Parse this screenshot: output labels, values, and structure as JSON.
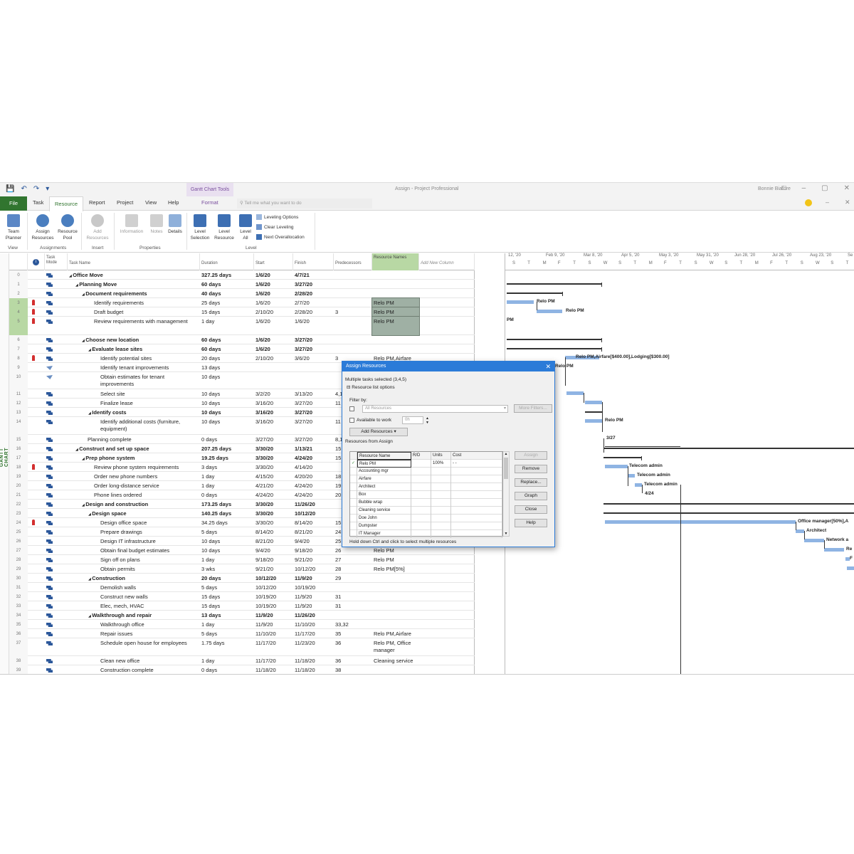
{
  "title_bar": {
    "context_tab": "Gantt Chart Tools",
    "window_title": "Assign  -  Project Professional",
    "user": "Bonnie Biafore"
  },
  "tabs": {
    "file": "File",
    "task": "Task",
    "resource": "Resource",
    "report": "Report",
    "project": "Project",
    "view": "View",
    "help": "Help",
    "format": "Format",
    "tell_me": "Tell me what you want to do"
  },
  "ribbon": {
    "team_planner": "Team Planner",
    "assign_resources": "Assign Resources",
    "resource_pool": "Resource Pool",
    "add_resources": "Add Resources",
    "information": "Information",
    "notes": "Notes",
    "details": "Details",
    "level_selection": "Level Selection",
    "level_resource": "Level Resource",
    "level_all": "Level All",
    "leveling_options": "Leveling Options",
    "clear_leveling": "Clear Leveling",
    "next_overallocation": "Next Overallocation",
    "groups": {
      "view": "View",
      "assignments": "Assignments",
      "insert": "Insert",
      "properties": "Properties",
      "level": "Level"
    }
  },
  "sheet": {
    "side_label": "GANTT CHART",
    "headers": {
      "task_mode": "Task Mode",
      "task_name": "Task Name",
      "duration": "Duration",
      "start": "Start",
      "finish": "Finish",
      "predecessors": "Predecessors",
      "resource_names": "Resource Names",
      "add_column": "Add New Column"
    },
    "rows": [
      {
        "id": "0",
        "name": "Office Move",
        "dur": "327.25 days",
        "start": "1/6/20",
        "fin": "4/7/21",
        "pred": "",
        "res": "",
        "lvl": 0,
        "bold": true,
        "h": 13
      },
      {
        "id": "1",
        "name": "Planning Move",
        "dur": "60 days",
        "start": "1/6/20",
        "fin": "3/27/20",
        "pred": "",
        "res": "",
        "lvl": 1,
        "bold": true,
        "h": 13
      },
      {
        "id": "2",
        "name": "Document requirements",
        "dur": "40 days",
        "start": "1/6/20",
        "fin": "2/28/20",
        "pred": "",
        "res": "",
        "lvl": 2,
        "bold": true,
        "h": 13
      },
      {
        "id": "3",
        "name": "Identify requirements",
        "dur": "25 days",
        "start": "1/6/20",
        "fin": "2/7/20",
        "pred": "",
        "res": "Relo PM",
        "lvl": 3,
        "bold": false,
        "h": 13,
        "pin": true,
        "hl": true
      },
      {
        "id": "4",
        "name": "Draft budget",
        "dur": "15 days",
        "start": "2/10/20",
        "fin": "2/28/20",
        "pred": "3",
        "res": "Relo PM",
        "lvl": 3,
        "bold": false,
        "h": 13,
        "pin": true,
        "hl": true
      },
      {
        "id": "5",
        "name": "Review requirements with management",
        "dur": "1 day",
        "start": "1/6/20",
        "fin": "1/6/20",
        "pred": "",
        "res": "Relo PM",
        "lvl": 3,
        "bold": false,
        "h": 26,
        "pin": true,
        "hl": true
      },
      {
        "id": "6",
        "name": "Choose new location",
        "dur": "60 days",
        "start": "1/6/20",
        "fin": "3/27/20",
        "pred": "",
        "res": "",
        "lvl": 2,
        "bold": true,
        "h": 13
      },
      {
        "id": "7",
        "name": "Evaluate lease sites",
        "dur": "60 days",
        "start": "1/6/20",
        "fin": "3/27/20",
        "pred": "",
        "res": "",
        "lvl": 3,
        "bold": true,
        "h": 13
      },
      {
        "id": "8",
        "name": "Identify potential sites",
        "dur": "20 days",
        "start": "2/10/20",
        "fin": "3/6/20",
        "pred": "3",
        "res": "Relo PM,Airfare",
        "lvl": 4,
        "bold": false,
        "h": 13,
        "pin": true
      },
      {
        "id": "9",
        "name": "Identify tenant improvements",
        "dur": "13 days",
        "start": "",
        "fin": "",
        "pred": "",
        "res": "",
        "lvl": 4,
        "bold": false,
        "h": 13,
        "manual": true
      },
      {
        "id": "10",
        "name": "Obtain estimates for tenant improvements",
        "dur": "10 days",
        "start": "",
        "fin": "",
        "pred": "",
        "res": "",
        "lvl": 4,
        "bold": false,
        "h": 24,
        "manual": true
      },
      {
        "id": "11",
        "name": "Select site",
        "dur": "10 days",
        "start": "3/2/20",
        "fin": "3/13/20",
        "pred": "4,1",
        "res": "",
        "lvl": 4,
        "bold": false,
        "h": 13
      },
      {
        "id": "12",
        "name": "Finalize lease",
        "dur": "10 days",
        "start": "3/16/20",
        "fin": "3/27/20",
        "pred": "11",
        "res": "",
        "lvl": 4,
        "bold": false,
        "h": 13
      },
      {
        "id": "13",
        "name": "Identify costs",
        "dur": "10 days",
        "start": "3/16/20",
        "fin": "3/27/20",
        "pred": "",
        "res": "",
        "lvl": 3,
        "bold": true,
        "h": 13
      },
      {
        "id": "14",
        "name": "Identify additional costs (furniture, equipment)",
        "dur": "10 days",
        "start": "3/16/20",
        "fin": "3/27/20",
        "pred": "11",
        "res": "",
        "lvl": 4,
        "bold": false,
        "h": 25
      },
      {
        "id": "15",
        "name": "Planning complete",
        "dur": "0 days",
        "start": "3/27/20",
        "fin": "3/27/20",
        "pred": "8,1",
        "res": "",
        "lvl": 2,
        "bold": false,
        "h": 13
      },
      {
        "id": "16",
        "name": "Construct and set up space",
        "dur": "207.25 days",
        "start": "3/30/20",
        "fin": "1/13/21",
        "pred": "15",
        "res": "",
        "lvl": 1,
        "bold": true,
        "h": 13
      },
      {
        "id": "17",
        "name": "Prep phone system",
        "dur": "19.25 days",
        "start": "3/30/20",
        "fin": "4/24/20",
        "pred": "15",
        "res": "",
        "lvl": 2,
        "bold": true,
        "h": 13
      },
      {
        "id": "18",
        "name": "Review phone system requirements",
        "dur": "3 days",
        "start": "3/30/20",
        "fin": "4/14/20",
        "pred": "",
        "res": "",
        "lvl": 3,
        "bold": false,
        "h": 13,
        "pin": true
      },
      {
        "id": "19",
        "name": "Order new phone numbers",
        "dur": "1 day",
        "start": "4/15/20",
        "fin": "4/20/20",
        "pred": "18",
        "res": "",
        "lvl": 3,
        "bold": false,
        "h": 13
      },
      {
        "id": "20",
        "name": "Order long-distance service",
        "dur": "1 day",
        "start": "4/21/20",
        "fin": "4/24/20",
        "pred": "19",
        "res": "",
        "lvl": 3,
        "bold": false,
        "h": 13
      },
      {
        "id": "21",
        "name": "Phone lines ordered",
        "dur": "0 days",
        "start": "4/24/20",
        "fin": "4/24/20",
        "pred": "20",
        "res": "",
        "lvl": 3,
        "bold": false,
        "h": 13
      },
      {
        "id": "22",
        "name": "Design and construction",
        "dur": "173.25 days",
        "start": "3/30/20",
        "fin": "11/26/20",
        "pred": "",
        "res": "",
        "lvl": 2,
        "bold": true,
        "h": 13
      },
      {
        "id": "23",
        "name": "Design space",
        "dur": "140.25 days",
        "start": "3/30/20",
        "fin": "10/12/20",
        "pred": "",
        "res": "",
        "lvl": 3,
        "bold": true,
        "h": 13
      },
      {
        "id": "24",
        "name": "Design office space",
        "dur": "34.25 days",
        "start": "3/30/20",
        "fin": "8/14/20",
        "pred": "15",
        "res": "",
        "lvl": 4,
        "bold": false,
        "h": 13,
        "pin": true
      },
      {
        "id": "25",
        "name": "Prepare drawings",
        "dur": "5 days",
        "start": "8/14/20",
        "fin": "8/21/20",
        "pred": "24",
        "res": "",
        "lvl": 4,
        "bold": false,
        "h": 13
      },
      {
        "id": "26",
        "name": "Design IT infrastructure",
        "dur": "10 days",
        "start": "8/21/20",
        "fin": "9/4/20",
        "pred": "25",
        "res": "",
        "lvl": 4,
        "bold": false,
        "h": 13
      },
      {
        "id": "27",
        "name": "Obtain final budget estimates",
        "dur": "10 days",
        "start": "9/4/20",
        "fin": "9/18/20",
        "pred": "26",
        "res": "Relo PM",
        "lvl": 4,
        "bold": false,
        "h": 13
      },
      {
        "id": "28",
        "name": "Sign off on plans",
        "dur": "1 day",
        "start": "9/18/20",
        "fin": "9/21/20",
        "pred": "27",
        "res": "Relo PM",
        "lvl": 4,
        "bold": false,
        "h": 13
      },
      {
        "id": "29",
        "name": "Obtain permits",
        "dur": "3 wks",
        "start": "9/21/20",
        "fin": "10/12/20",
        "pred": "28",
        "res": "Relo PM[5%]",
        "lvl": 4,
        "bold": false,
        "h": 13
      },
      {
        "id": "30",
        "name": "Construction",
        "dur": "20 days",
        "start": "10/12/20",
        "fin": "11/9/20",
        "pred": "29",
        "res": "",
        "lvl": 3,
        "bold": true,
        "h": 13
      },
      {
        "id": "31",
        "name": "Demolish walls",
        "dur": "5 days",
        "start": "10/12/20",
        "fin": "10/19/20",
        "pred": "",
        "res": "",
        "lvl": 4,
        "bold": false,
        "h": 13
      },
      {
        "id": "32",
        "name": "Construct new walls",
        "dur": "15 days",
        "start": "10/19/20",
        "fin": "11/9/20",
        "pred": "31",
        "res": "",
        "lvl": 4,
        "bold": false,
        "h": 13
      },
      {
        "id": "33",
        "name": "Elec, mech, HVAC",
        "dur": "15 days",
        "start": "10/19/20",
        "fin": "11/9/20",
        "pred": "31",
        "res": "",
        "lvl": 4,
        "bold": false,
        "h": 13
      },
      {
        "id": "34",
        "name": "Walkthrough and repair",
        "dur": "13 days",
        "start": "11/9/20",
        "fin": "11/26/20",
        "pred": "",
        "res": "",
        "lvl": 3,
        "bold": true,
        "h": 13
      },
      {
        "id": "35",
        "name": "Walkthrough office",
        "dur": "1 day",
        "start": "11/9/20",
        "fin": "11/10/20",
        "pred": "33,32",
        "res": "",
        "lvl": 4,
        "bold": false,
        "h": 13
      },
      {
        "id": "36",
        "name": "Repair issues",
        "dur": "5 days",
        "start": "11/10/20",
        "fin": "11/17/20",
        "pred": "35",
        "res": "Relo PM,Airfare",
        "lvl": 4,
        "bold": false,
        "h": 13
      },
      {
        "id": "37",
        "name": "Schedule open house for employees",
        "dur": "1.75 days",
        "start": "11/17/20",
        "fin": "11/23/20",
        "pred": "36",
        "res": "Relo PM, Office manager",
        "lvl": 4,
        "bold": false,
        "h": 25
      },
      {
        "id": "38",
        "name": "Clean new office",
        "dur": "1 day",
        "start": "11/17/20",
        "fin": "11/18/20",
        "pred": "36",
        "res": "Cleaning service",
        "lvl": 4,
        "bold": false,
        "h": 13
      },
      {
        "id": "39",
        "name": "Construction complete",
        "dur": "0 days",
        "start": "11/18/20",
        "fin": "11/18/20",
        "pred": "38",
        "res": "",
        "lvl": 4,
        "bold": false,
        "h": 13
      }
    ]
  },
  "gantt": {
    "weeks": [
      "12, '20",
      "Feb 9, '20",
      "Mar 8, '20",
      "Apr 5, '20",
      "May 3, '20",
      "May 31, '20",
      "Jun 28, '20",
      "Jul 26, '20",
      "Aug 23, '20",
      "Se"
    ],
    "days": [
      "S",
      "T",
      "M",
      "F",
      "T",
      "S",
      "W",
      "S",
      "T",
      "M",
      "F",
      "T",
      "S",
      "W",
      "S",
      "T",
      "M",
      "F",
      "T",
      "S",
      "W",
      "S",
      "T"
    ],
    "labels": {
      "relo_pm_1": "Relo PM",
      "relo_pm_2": "Relo PM",
      "pm": "PM",
      "airfare_lodging": "Relo PM,Airfare[$400.00],Lodging[$300.00]",
      "relo_pm_3": "Relo PM",
      "relo_pm_4": "Relo PM",
      "milestone_327": "3/27",
      "telecom_1": "Telecom admin",
      "telecom_2": "Telecom admin",
      "telecom_3": "Telecom admin",
      "milestone_424": "4/24",
      "office_mgr": "Office manager[50%],A",
      "architect": "Architect",
      "network": "Network a",
      "re": "Re",
      "f": "F"
    }
  },
  "dialog": {
    "title": "Assign Resources",
    "selected_info": "Multiple tasks selected (3,4,5)",
    "resource_list_options": "Resource list options",
    "filter_by": "Filter by:",
    "filter_value": "All Resources",
    "more_filters": "More Filters...",
    "available_to_work": "Available to work",
    "available_value": "0h",
    "add_resources": "Add Resources",
    "resources_from": "Resources from Assign",
    "columns": {
      "name": "Resource Name",
      "rd": "R/D",
      "units": "Units",
      "cost": "Cost"
    },
    "resources": [
      {
        "name": "Relo PM",
        "units": "100%",
        "cost": "- -",
        "checked": true
      },
      {
        "name": "Accounting mgr",
        "units": "",
        "cost": "",
        "checked": false
      },
      {
        "name": "Airfare",
        "units": "",
        "cost": "",
        "checked": false
      },
      {
        "name": "Architect",
        "units": "",
        "cost": "",
        "checked": false
      },
      {
        "name": "Box",
        "units": "",
        "cost": "",
        "checked": false
      },
      {
        "name": "Bubble wrap",
        "units": "",
        "cost": "",
        "checked": false
      },
      {
        "name": "Cleaning service",
        "units": "",
        "cost": "",
        "checked": false
      },
      {
        "name": "Doe John",
        "units": "",
        "cost": "",
        "checked": false
      },
      {
        "name": "Dumpster",
        "units": "",
        "cost": "",
        "checked": false
      },
      {
        "name": "IT Manager",
        "units": "",
        "cost": "",
        "checked": false
      }
    ],
    "buttons": {
      "assign": "Assign",
      "remove": "Remove",
      "replace": "Replace...",
      "graph": "Graph",
      "close": "Close",
      "help": "Help"
    },
    "hint": "Hold down Ctrl and click to select multiple resources"
  }
}
